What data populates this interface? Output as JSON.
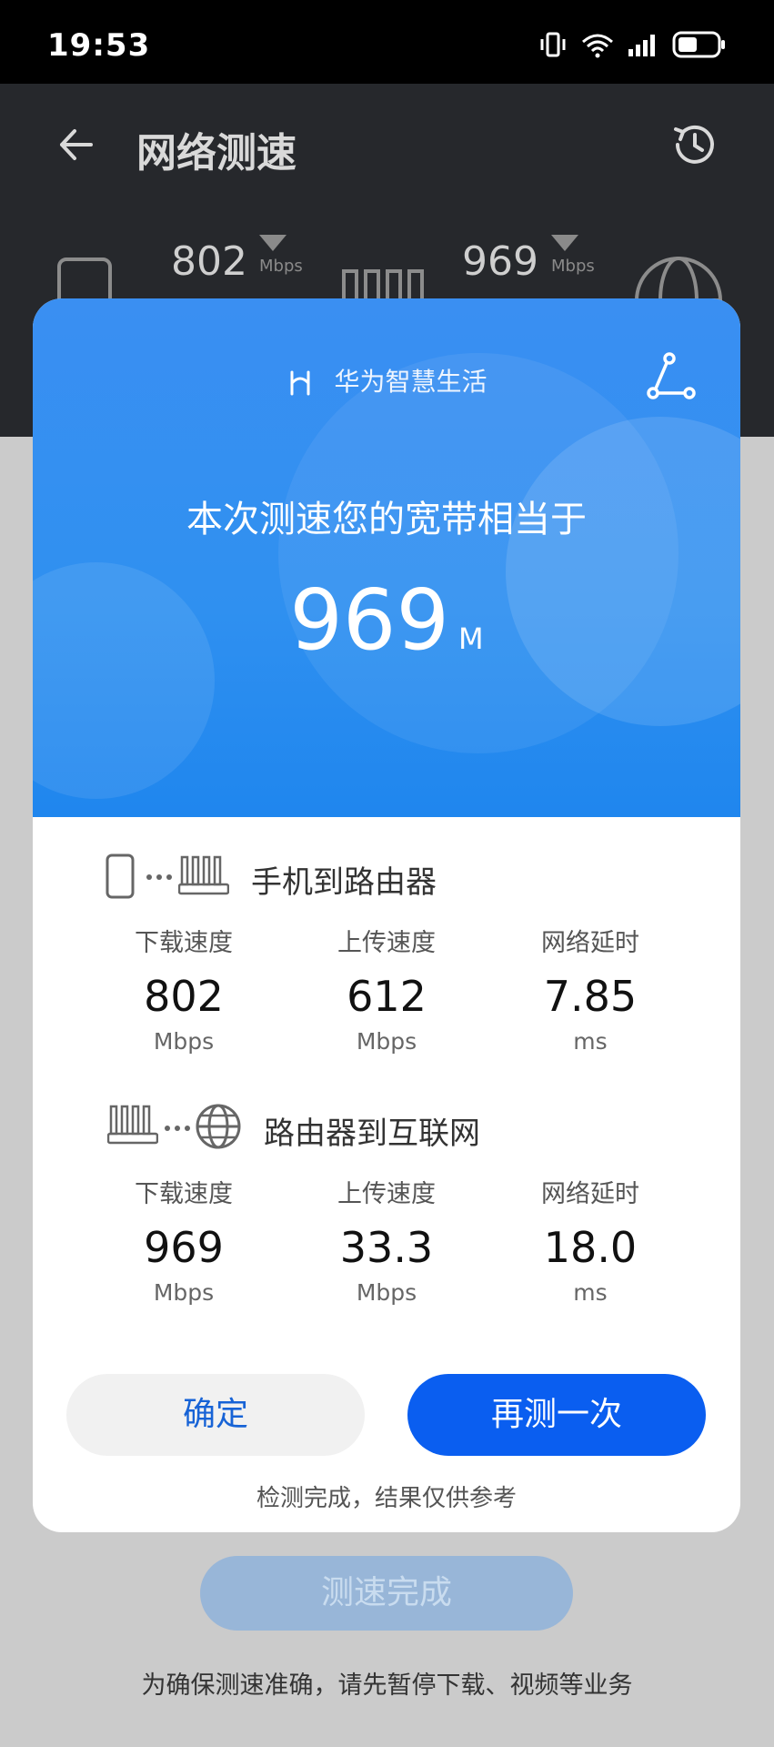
{
  "status": {
    "time": "19:53"
  },
  "header": {
    "title": "网络测速"
  },
  "topology": {
    "phone_router_speed": "802",
    "router_internet_speed": "969",
    "unit": "Mbps"
  },
  "dialog": {
    "brand": "华为智慧生活",
    "headline": "本次测速您的宽带相当于",
    "speed_value": "969",
    "speed_unit": "M",
    "sections": [
      {
        "title": "手机到路由器",
        "metrics": [
          {
            "label": "下载速度",
            "value": "802",
            "unit": "Mbps"
          },
          {
            "label": "上传速度",
            "value": "612",
            "unit": "Mbps"
          },
          {
            "label": "网络延时",
            "value": "7.85",
            "unit": "ms"
          }
        ]
      },
      {
        "title": "路由器到互联网",
        "metrics": [
          {
            "label": "下载速度",
            "value": "969",
            "unit": "Mbps"
          },
          {
            "label": "上传速度",
            "value": "33.3",
            "unit": "Mbps"
          },
          {
            "label": "网络延时",
            "value": "18.0",
            "unit": "ms"
          }
        ]
      }
    ],
    "confirm_label": "确定",
    "retest_label": "再测一次",
    "note": "检测完成，结果仅供参考"
  },
  "background": {
    "done_button": "测速完成",
    "tip": "为确保测速准确，请先暂停下载、视频等业务"
  }
}
